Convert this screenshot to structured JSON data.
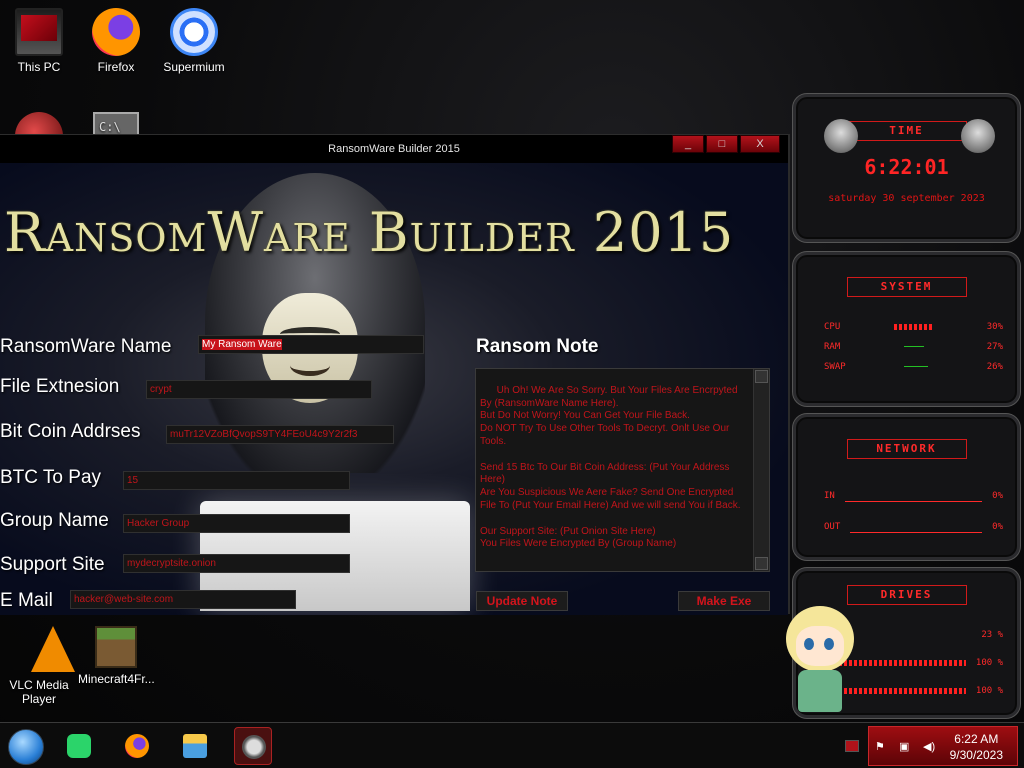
{
  "desktop_icons": {
    "this_pc": "This PC",
    "firefox": "Firefox",
    "supermium": "Supermium",
    "vlc": "VLC Media Player",
    "minecraft": "Minecraft4Fr..."
  },
  "window": {
    "title": "RansomWare Builder 2015",
    "minimize": "_",
    "maximize": "□",
    "close": "X"
  },
  "app": {
    "banner": "RansomWare Builder 2015",
    "labels": {
      "name": "RansomWare Name",
      "extension": "File Extnesion",
      "bitcoin": "Bit Coin Addrses",
      "btc_pay": "BTC To Pay",
      "group": "Group Name",
      "support": "Support Site",
      "email": "E Mail",
      "ransom_note": "Ransom Note"
    },
    "values": {
      "name": "My Ransom Ware",
      "extension": "crypt",
      "bitcoin": "muTr12VZoBfQvopS9TY4FEoU4c9Y2r2f3",
      "btc_pay": "15",
      "group": "Hacker Group",
      "support": "mydecryptsite.onion",
      "email": "hacker@web-site.com"
    },
    "note_text": "Uh Oh! We Are So Sorry. But Your Files Are Encrpyted By (RansomWare Name Here).\nBut Do Not Worry! You Can Get Your File Back.\nDo NOT Try To Use Other Tools To Decryt. Onlt Use Our Tools.\n\nSend 15 Btc To Our Bit Coin Address: (Put Your Address Here)\nAre You Suspicious We Aere Fake? Send One Encrypted File To (Put Your Email Here) And we will send You if Back.\n\nOur Support Site: (Put Onion Site Here)\nYou Files Were Encrypted By (Group Name)",
    "update_button": "Update Note",
    "make_button": "Make Exe"
  },
  "gadgets": {
    "time_header": "TIME",
    "time": "6:22:01",
    "date": "saturday 30 september 2023",
    "system_header": "SYSTEM",
    "cpu_label": "CPU",
    "cpu_value": "30%",
    "ram_label": "RAM",
    "ram_value": "27%",
    "swap_label": "SWAP",
    "swap_value": "26%",
    "network_header": "NETWORK",
    "in_label": "IN",
    "in_value": "0%",
    "out_label": "OUT",
    "out_value": "0%",
    "drives_header": "DRIVES",
    "drive1": "23 %",
    "drive2": "100 %",
    "drive3": "100 %"
  },
  "taskbar": {
    "time": "6:22 AM",
    "date": "9/30/2023"
  },
  "colors": {
    "accent": "#c8131b",
    "window_bg": "#0b0e1e",
    "field_text": "#c0151b"
  }
}
